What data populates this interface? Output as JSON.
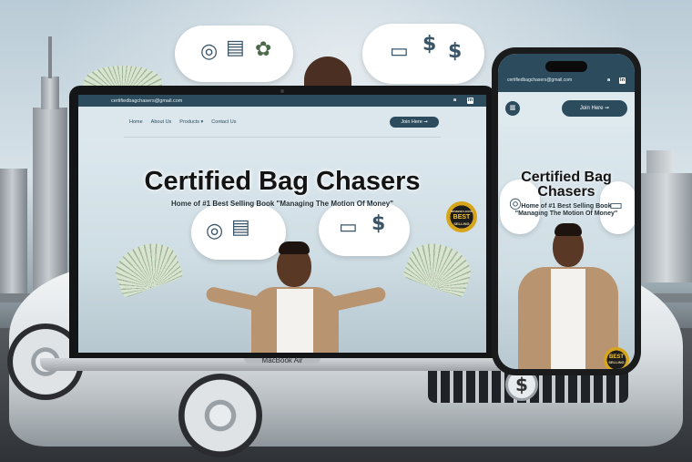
{
  "site": {
    "email": "certifiedbagchasers@gmail.com",
    "social": [
      "amazon-icon",
      "linkedin-icon"
    ],
    "nav": {
      "items": [
        "Home",
        "About Us",
        "Products ▾",
        "Contact Us"
      ],
      "join_label": "Join Here ➞"
    },
    "hero": {
      "title": "Certified Bag Chasers",
      "subtitle": "Home of #1 Best Selling Book \"Managing The Motion Of Money\"",
      "seal_top": "BEST",
      "seal_bottom": "SELLING",
      "seal_brand": "amazon.com"
    }
  },
  "devices": {
    "laptop_label": "MacBook Air"
  },
  "colors": {
    "brand": "#2c4c5e",
    "hero_bg": "#dce8ee",
    "seal_gold": "#d6a51b"
  }
}
